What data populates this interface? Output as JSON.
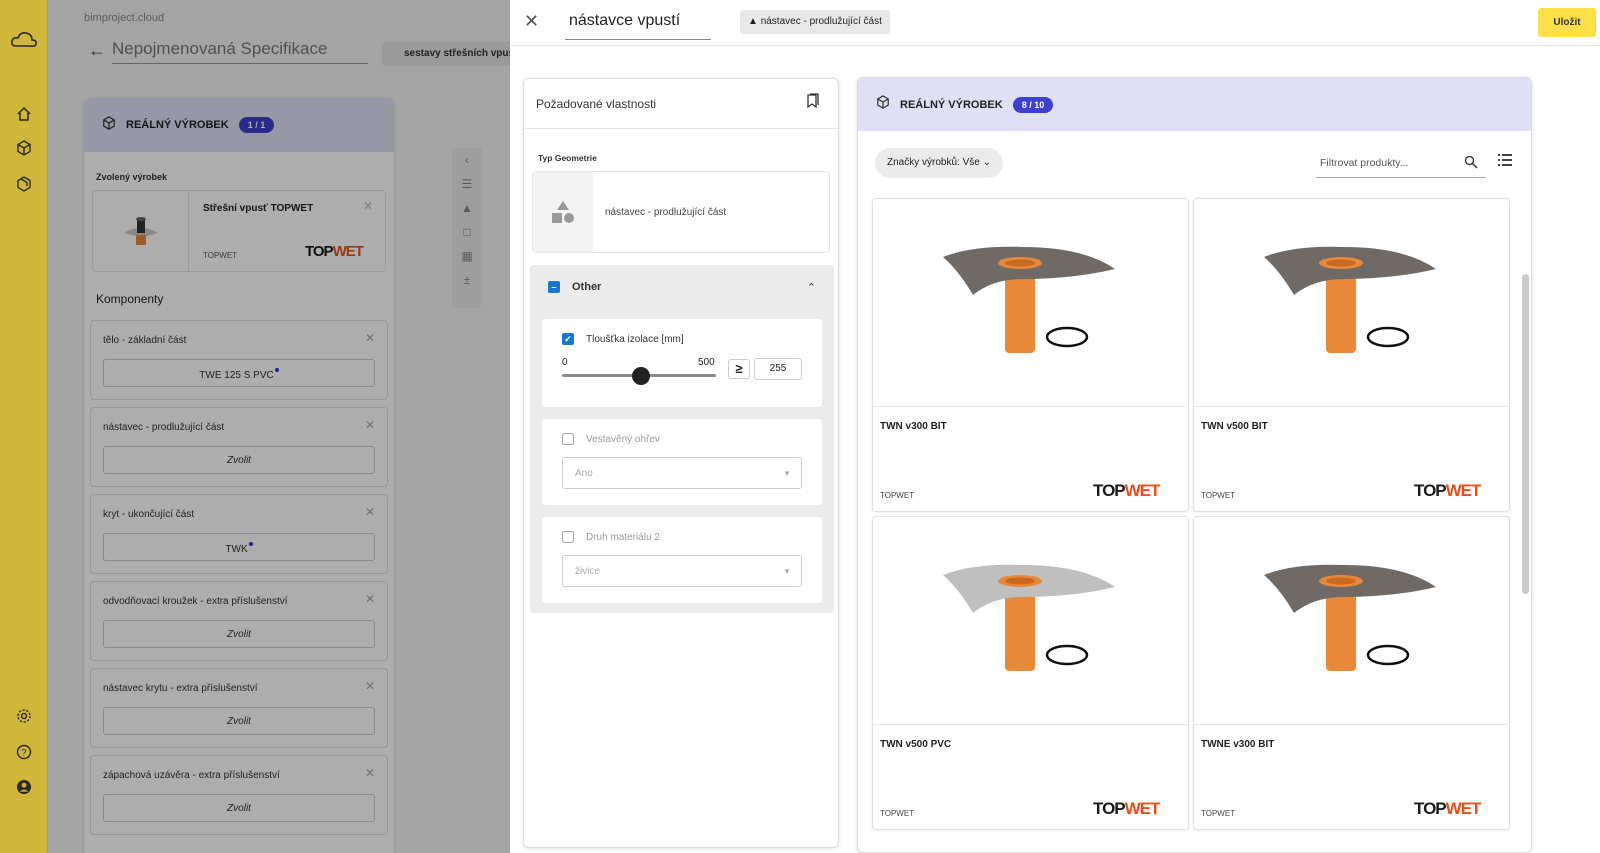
{
  "app": {
    "site": "bimproject.cloud",
    "spec_title": "Nepojmenovaná Specifikace",
    "set_chip": "sestavy střešních vpustí"
  },
  "bg_panel": {
    "header": "REÁLNÝ VÝROBEK",
    "count": "1 / 1",
    "selected_label": "Zvolený výrobek",
    "selected_name": "Střešní vpusť TOPWET",
    "selected_brand": "TOPWET",
    "components_title": "Komponenty",
    "components": [
      {
        "label": "tělo - základní část",
        "value": "TWE 125 S PVC",
        "chosen": true
      },
      {
        "label": "nástavec - prodlužující část",
        "value": "Zvolit",
        "chosen": false
      },
      {
        "label": "kryt - ukončující část",
        "value": "TWK",
        "chosen": true
      },
      {
        "label": "odvodňovací kroužek - extra příslušenství",
        "value": "Zvolit",
        "chosen": false
      },
      {
        "label": "nástavec krytu - extra příslušenství",
        "value": "Zvolit",
        "chosen": false
      },
      {
        "label": "zápachová uzávěra - extra příslušenství",
        "value": "Zvolit",
        "chosen": false
      }
    ]
  },
  "dialog": {
    "title": "nástavce vpustí",
    "chip": "nástavec - prodlužující část",
    "save": "Uložit"
  },
  "filters": {
    "title": "Požadované vlastnosti",
    "geometry_label": "Typ Geometrie",
    "geometry_value": "nástavec - prodlužující část",
    "group": "Other",
    "thickness": {
      "label": "Tloušťka izolace [mm]",
      "min": "0",
      "max": "500",
      "op": "≥",
      "value": "255",
      "fraction": 0.51
    },
    "heating": {
      "label": "Vestavěný ohřev",
      "option": "Ano"
    },
    "material": {
      "label": "Druh materiálu 2",
      "option": "živice"
    }
  },
  "products": {
    "header": "REÁLNÝ VÝROBEK",
    "count": "8 / 10",
    "brands_filter": "Značky výrobků: Vše",
    "search_placeholder": "Filtrovat produkty...",
    "items": [
      {
        "name": "TWN v300 BIT",
        "brand": "TOPWET",
        "flange": "#6f6a66"
      },
      {
        "name": "TWN v500 BIT",
        "brand": "TOPWET",
        "flange": "#6f6a66"
      },
      {
        "name": "TWN v500 PVC",
        "brand": "TOPWET",
        "flange": "#bfbfbf"
      },
      {
        "name": "TWNE v300 BIT",
        "brand": "TOPWET",
        "flange": "#6f6a66"
      }
    ],
    "logo_text_a": "TOP",
    "logo_text_b": "WET"
  },
  "colors": {
    "accent": "#fde047",
    "pill": "#3d3fcf",
    "header_bg": "#dfe0f5",
    "checkbox": "#1976d2",
    "pipe": "#e8893a"
  }
}
